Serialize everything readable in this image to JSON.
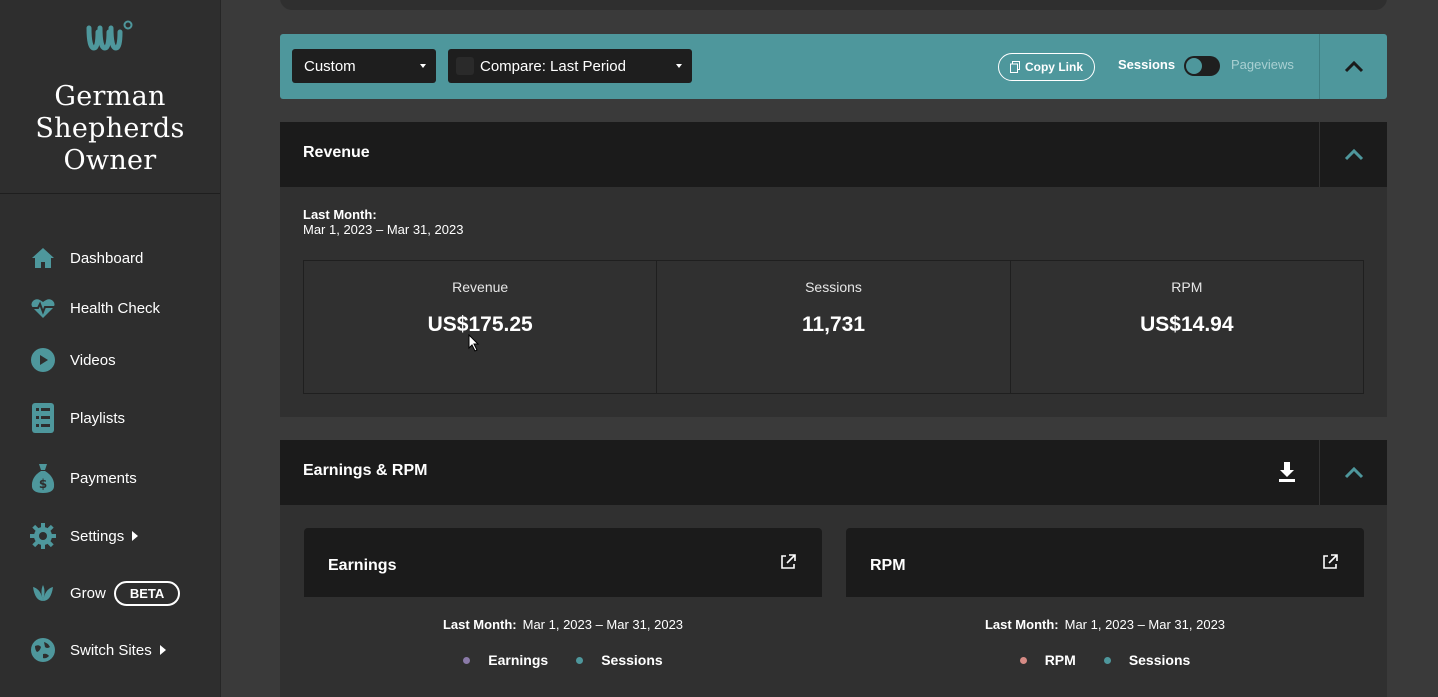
{
  "site": {
    "name_line1": "German",
    "name_line2": "Shepherds",
    "name_line3": "Owner"
  },
  "sidebar": {
    "items": [
      {
        "label": "Dashboard",
        "icon": "home-icon"
      },
      {
        "label": "Health Check",
        "icon": "heartbeat-icon"
      },
      {
        "label": "Videos",
        "icon": "play-icon"
      },
      {
        "label": "Playlists",
        "icon": "list-icon"
      },
      {
        "label": "Payments",
        "icon": "money-bag-icon"
      },
      {
        "label": "Settings",
        "icon": "gear-icon"
      },
      {
        "label": "Grow",
        "icon": "leaf-icon",
        "badge": "BETA"
      },
      {
        "label": "Switch Sites",
        "icon": "globe-icon"
      }
    ]
  },
  "filters": {
    "range": "Custom",
    "compare": "Compare: Last Period",
    "copy_link": "Copy Link",
    "toggle_left": "Sessions",
    "toggle_right": "Pageviews"
  },
  "revenue": {
    "title": "Revenue",
    "period_label": "Last Month:",
    "period_range": "Mar 1, 2023 – Mar 31, 2023",
    "stats": [
      {
        "label": "Revenue",
        "value": "US$175.25"
      },
      {
        "label": "Sessions",
        "value": "11,731"
      },
      {
        "label": "RPM",
        "value": "US$14.94"
      }
    ]
  },
  "earnings_rpm": {
    "title": "Earnings & RPM",
    "cards": [
      {
        "title": "Earnings",
        "period_label": "Last Month:",
        "period_range": "Mar 1, 2023 – Mar 31, 2023",
        "legend": [
          {
            "label": "Earnings",
            "color": "#8a7aa8"
          },
          {
            "label": "Sessions",
            "color": "#4e979c"
          }
        ]
      },
      {
        "title": "RPM",
        "period_label": "Last Month:",
        "period_range": "Mar 1, 2023 – Mar 31, 2023",
        "legend": [
          {
            "label": "RPM",
            "color": "#d68b85"
          },
          {
            "label": "Sessions",
            "color": "#4e979c"
          }
        ]
      }
    ]
  },
  "colors": {
    "accent": "#4e979c",
    "panel_head": "#1b1b1b",
    "sidebar": "#2e2e2e"
  }
}
